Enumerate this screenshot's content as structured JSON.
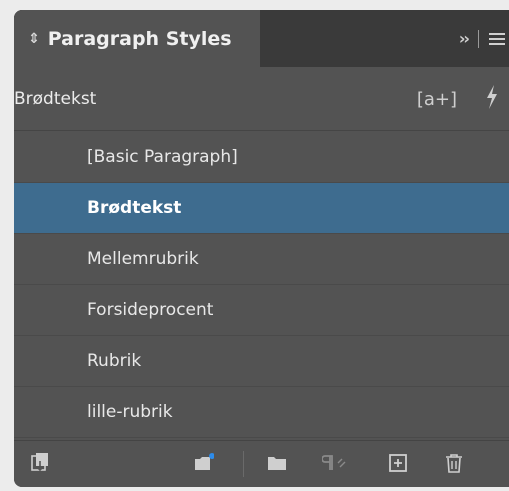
{
  "panel": {
    "title": "Paragraph Styles",
    "current_style": "Brødtekst"
  },
  "header": {
    "updown_glyph": "◊",
    "new_style_glyph": "[a+]",
    "collapse_glyph": "››"
  },
  "styles": [
    {
      "label": "[Basic Paragraph]",
      "selected": false
    },
    {
      "label": "Brødtekst",
      "selected": true
    },
    {
      "label": "Mellemrubrik",
      "selected": false
    },
    {
      "label": "Forsideprocent",
      "selected": false
    },
    {
      "label": "Rubrik",
      "selected": false
    },
    {
      "label": "lille-rubrik",
      "selected": false
    }
  ],
  "bottombar": {
    "icons": [
      "load-styles-icon",
      "clear-overrides-icon",
      "new-group-icon",
      "paragraph-style-icon",
      "new-style-icon",
      "delete-icon"
    ]
  },
  "colors": {
    "panel_bg": "#535353",
    "tabbar_bg": "#3a3a3a",
    "selection": "#3e6c8f",
    "accent_dot": "#2d8ceb"
  }
}
